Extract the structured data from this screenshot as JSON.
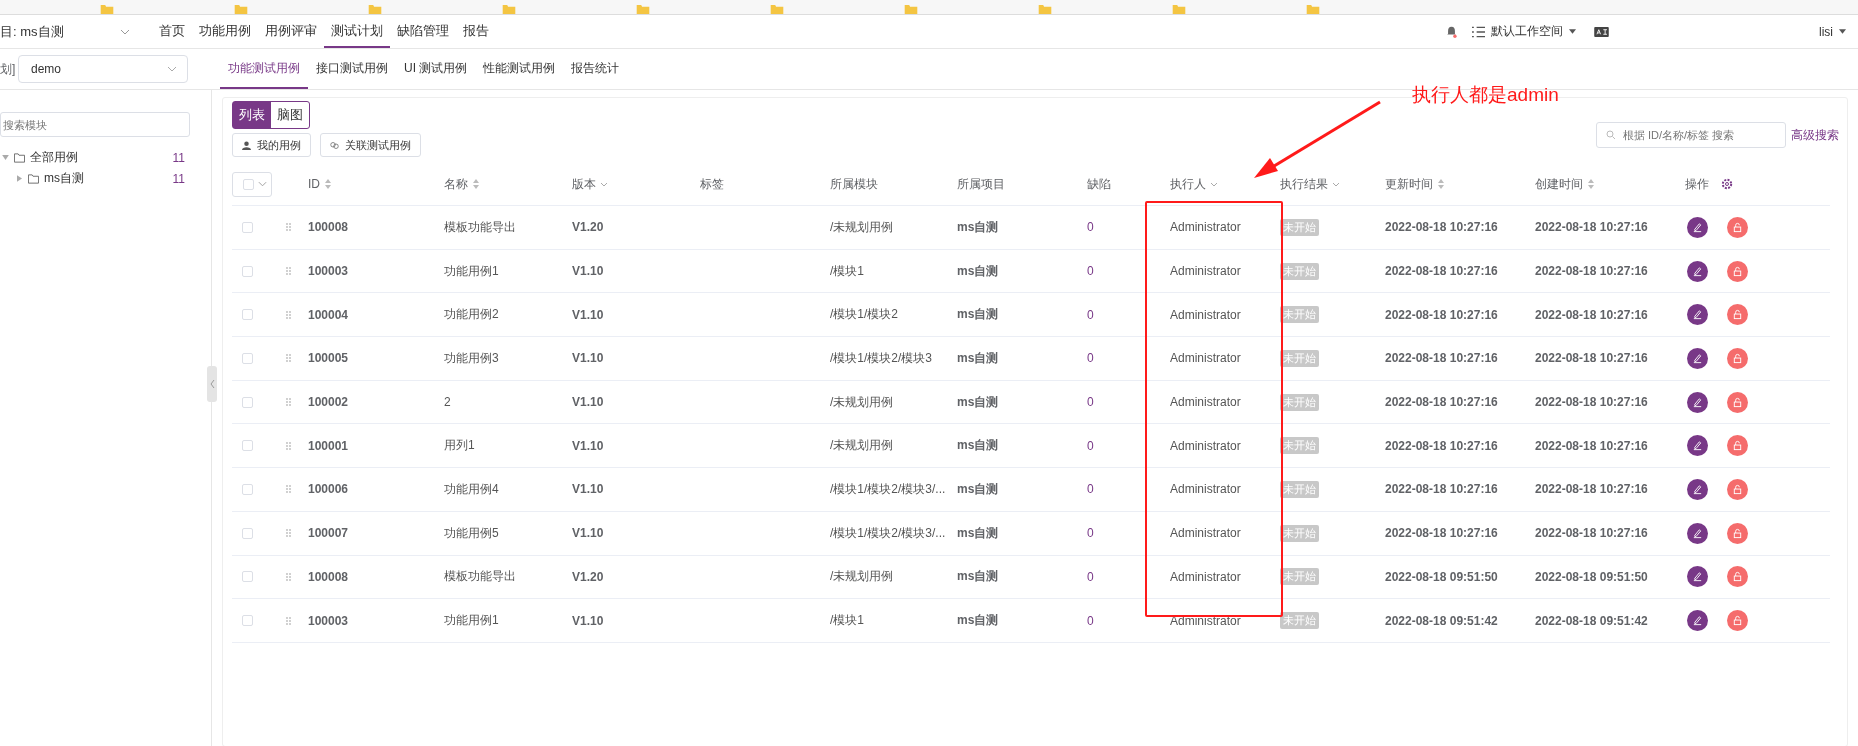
{
  "top_nav": {
    "project_label": "目: ms自测",
    "items": [
      {
        "label": "首页",
        "selected": false
      },
      {
        "label": "功能用例",
        "selected": false
      },
      {
        "label": "用例评审",
        "selected": false
      },
      {
        "label": "测试计划",
        "selected": true
      },
      {
        "label": "缺陷管理",
        "selected": false
      },
      {
        "label": "报告",
        "selected": false
      }
    ],
    "workspace": "默认工作空间",
    "user": "lisi"
  },
  "sub_nav": {
    "version_label": "划]",
    "version_value": "demo",
    "tabs": [
      {
        "label": "功能测试用例",
        "selected": true
      },
      {
        "label": "接口测试用例",
        "selected": false
      },
      {
        "label": "UI 测试用例",
        "selected": false
      },
      {
        "label": "性能测试用例",
        "selected": false
      },
      {
        "label": "报告统计",
        "selected": false
      }
    ]
  },
  "sidebar": {
    "search": {
      "placeholder": "搜索模块"
    },
    "tree": [
      {
        "label": "全部用例",
        "count": "11",
        "expanded": true,
        "children": [
          {
            "label": "ms自测",
            "count": "11",
            "expanded": false
          }
        ]
      }
    ]
  },
  "toolbar": {
    "views": [
      {
        "label": "列表",
        "selected": true
      },
      {
        "label": "脑图",
        "selected": false
      }
    ],
    "buttons": [
      {
        "label": "我的用例",
        "kind": "user"
      },
      {
        "label": "关联测试用例",
        "kind": "link"
      }
    ],
    "search": {
      "placeholder": "根据 ID/名称/标签 搜索"
    },
    "advanced_search": "高级搜索"
  },
  "table": {
    "select_all_checked": false,
    "columns": [
      {
        "label": "ID",
        "kind": "sortable"
      },
      {
        "label": "名称",
        "kind": "sortable"
      },
      {
        "label": "版本",
        "kind": "filterable"
      },
      {
        "label": "标签",
        "kind": "plain"
      },
      {
        "label": "所属模块",
        "kind": "plain"
      },
      {
        "label": "所属项目",
        "kind": "plain"
      },
      {
        "label": "缺陷",
        "kind": "plain"
      },
      {
        "label": "执行人",
        "kind": "filterable"
      },
      {
        "label": "执行结果",
        "kind": "filterable"
      },
      {
        "label": "更新时间",
        "kind": "sortable"
      },
      {
        "label": "创建时间",
        "kind": "sortable"
      },
      {
        "label": "操作",
        "kind": "settings"
      }
    ],
    "rows": [
      {
        "checked": false,
        "id": "100008",
        "name": "模板功能导出",
        "version": "V1.20",
        "module": "/未规划用例",
        "project": "ms自测",
        "defects": "0",
        "executor": "Administrator",
        "result": "未开始",
        "updated": "2022-08-18 10:27:16",
        "created": "2022-08-18 10:27:16"
      },
      {
        "checked": false,
        "id": "100003",
        "name": "功能用例1",
        "version": "V1.10",
        "module": "/模块1",
        "project": "ms自测",
        "defects": "0",
        "executor": "Administrator",
        "result": "未开始",
        "updated": "2022-08-18 10:27:16",
        "created": "2022-08-18 10:27:16"
      },
      {
        "checked": false,
        "id": "100004",
        "name": "功能用例2",
        "version": "V1.10",
        "module": "/模块1/模块2",
        "project": "ms自测",
        "defects": "0",
        "executor": "Administrator",
        "result": "未开始",
        "updated": "2022-08-18 10:27:16",
        "created": "2022-08-18 10:27:16"
      },
      {
        "checked": false,
        "id": "100005",
        "name": "功能用例3",
        "version": "V1.10",
        "module": "/模块1/模块2/模块3",
        "project": "ms自测",
        "defects": "0",
        "executor": "Administrator",
        "result": "未开始",
        "updated": "2022-08-18 10:27:16",
        "created": "2022-08-18 10:27:16"
      },
      {
        "checked": false,
        "id": "100002",
        "name": "2",
        "version": "V1.10",
        "module": "/未规划用例",
        "project": "ms自测",
        "defects": "0",
        "executor": "Administrator",
        "result": "未开始",
        "updated": "2022-08-18 10:27:16",
        "created": "2022-08-18 10:27:16"
      },
      {
        "checked": false,
        "id": "100001",
        "name": "用列1",
        "version": "V1.10",
        "module": "/未规划用例",
        "project": "ms自测",
        "defects": "0",
        "executor": "Administrator",
        "result": "未开始",
        "updated": "2022-08-18 10:27:16",
        "created": "2022-08-18 10:27:16"
      },
      {
        "checked": false,
        "id": "100006",
        "name": "功能用例4",
        "version": "V1.10",
        "module": "/模块1/模块2/模块3/...",
        "project": "ms自测",
        "defects": "0",
        "executor": "Administrator",
        "result": "未开始",
        "updated": "2022-08-18 10:27:16",
        "created": "2022-08-18 10:27:16"
      },
      {
        "checked": false,
        "id": "100007",
        "name": "功能用例5",
        "version": "V1.10",
        "module": "/模块1/模块2/模块3/...",
        "project": "ms自测",
        "defects": "0",
        "executor": "Administrator",
        "result": "未开始",
        "updated": "2022-08-18 10:27:16",
        "created": "2022-08-18 10:27:16"
      },
      {
        "checked": false,
        "id": "100008",
        "name": "模板功能导出",
        "version": "V1.20",
        "module": "/未规划用例",
        "project": "ms自测",
        "defects": "0",
        "executor": "Administrator",
        "result": "未开始",
        "updated": "2022-08-18 09:51:50",
        "created": "2022-08-18 09:51:50"
      },
      {
        "checked": false,
        "id": "100003",
        "name": "功能用例1",
        "version": "V1.10",
        "module": "/模块1",
        "project": "ms自测",
        "defects": "0",
        "executor": "Administrator",
        "result": "未开始",
        "updated": "2022-08-18 09:51:42",
        "created": "2022-08-18 09:51:42"
      }
    ]
  },
  "annotation": {
    "text": "执行人都是admin"
  }
}
